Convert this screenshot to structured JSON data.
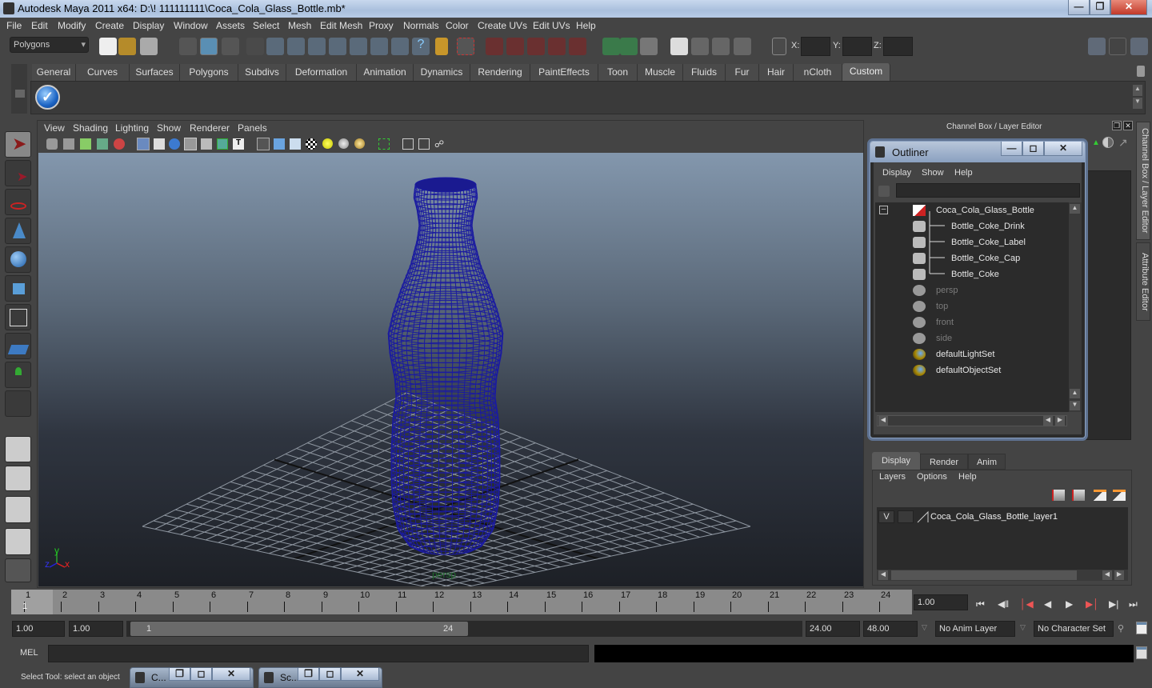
{
  "window": {
    "title": "Autodesk Maya 2011 x64: D:\\! 111111111\\Coca_Cola_Glass_Bottle.mb*",
    "controls": [
      "minimize",
      "restore",
      "close"
    ]
  },
  "menubar": {
    "items": [
      "File",
      "Edit",
      "Modify",
      "Create",
      "Display",
      "Window",
      "Assets",
      "Select",
      "Mesh",
      "Edit Mesh",
      "Proxy",
      "Normals",
      "Color",
      "Create UVs",
      "Edit UVs",
      "Help"
    ]
  },
  "status_line": {
    "mode_dropdown": "Polygons",
    "x_label": "X:",
    "y_label": "Y:",
    "z_label": "Z:",
    "x_value": "",
    "y_value": "",
    "z_value": ""
  },
  "shelf": {
    "tabs": [
      "General",
      "Curves",
      "Surfaces",
      "Polygons",
      "Subdivs",
      "Deformation",
      "Animation",
      "Dynamics",
      "Rendering",
      "PaintEffects",
      "Toon",
      "Muscle",
      "Fluids",
      "Fur",
      "Hair",
      "nCloth",
      "Custom"
    ],
    "active_tab": "Custom"
  },
  "viewport": {
    "menu": [
      "View",
      "Shading",
      "Lighting",
      "Show",
      "Renderer",
      "Panels"
    ],
    "camera_label": "persp",
    "axis": {
      "x": "x",
      "y": "y",
      "z": "z"
    },
    "wireframe_color": "#1a1aa0"
  },
  "channel_box": {
    "title": "Channel Box / Layer Editor",
    "side_tabs": [
      "Channel Box / Layer Editor",
      "Attribute Editor"
    ]
  },
  "outliner": {
    "title": "Outliner",
    "menu": [
      "Display",
      "Show",
      "Help"
    ],
    "filter_value": "",
    "items": [
      {
        "label": "Coca_Cola_Glass_Bottle",
        "type": "group",
        "dim": false,
        "expanded": true
      },
      {
        "label": "Bottle_Coke_Drink",
        "type": "mesh",
        "dim": false
      },
      {
        "label": "Bottle_Coke_Label",
        "type": "mesh",
        "dim": false
      },
      {
        "label": "Bottle_Coke_Cap",
        "type": "mesh",
        "dim": false
      },
      {
        "label": "Bottle_Coke",
        "type": "mesh",
        "dim": false
      },
      {
        "label": "persp",
        "type": "camera",
        "dim": true
      },
      {
        "label": "top",
        "type": "camera",
        "dim": true
      },
      {
        "label": "front",
        "type": "camera",
        "dim": true
      },
      {
        "label": "side",
        "type": "camera",
        "dim": true
      },
      {
        "label": "defaultLightSet",
        "type": "set",
        "dim": false
      },
      {
        "label": "defaultObjectSet",
        "type": "set",
        "dim": false
      }
    ]
  },
  "layer_editor": {
    "tabs": [
      "Display",
      "Render",
      "Anim"
    ],
    "active_tab": "Display",
    "menu": [
      "Layers",
      "Options",
      "Help"
    ],
    "layers": [
      {
        "visible": "V",
        "name": "Coca_Cola_Glass_Bottle_layer1"
      }
    ]
  },
  "timeline": {
    "ticks": [
      "1",
      "2",
      "3",
      "4",
      "5",
      "6",
      "7",
      "8",
      "9",
      "10",
      "11",
      "12",
      "13",
      "14",
      "15",
      "16",
      "17",
      "18",
      "19",
      "20",
      "21",
      "22",
      "23",
      "24"
    ],
    "current_frame_marker": "1",
    "current_time": "1.00"
  },
  "range_slider": {
    "start_time": "1.00",
    "playback_start": "1.00",
    "range_start_label": "1",
    "range_end_label": "24",
    "playback_end": "24.00",
    "end_time": "48.00",
    "anim_layer": "No Anim Layer",
    "character_set": "No Character Set"
  },
  "command_line": {
    "label": "MEL",
    "value": "",
    "result": ""
  },
  "help_line": {
    "text": "Select Tool: select an object"
  },
  "minimized_windows": [
    {
      "label": "C..."
    },
    {
      "label": "Sc..."
    }
  ]
}
